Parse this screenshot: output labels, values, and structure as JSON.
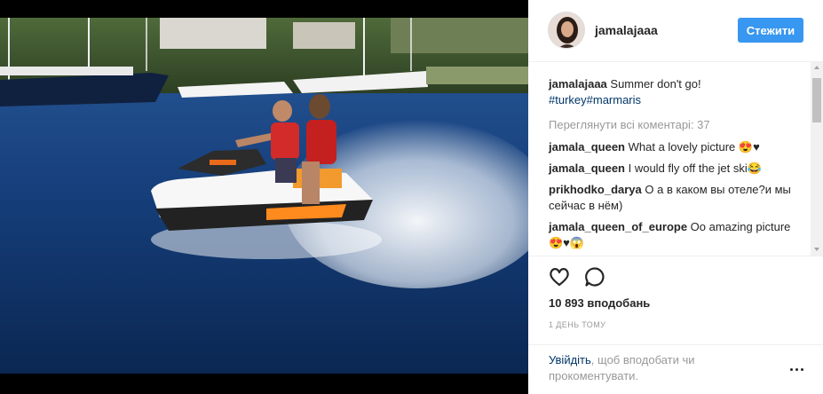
{
  "post": {
    "username": "jamalajaaa",
    "follow_label": "Стежити"
  },
  "caption": {
    "username": "jamalajaaa",
    "text": " Summer don't go!",
    "tags": "#turkey#marmaris"
  },
  "view_all_comments": "Переглянути всі коментарі: 37",
  "comments": [
    {
      "user": "jamala_queen",
      "text": " What a lovely picture 😍♥"
    },
    {
      "user": "jamala_queen",
      "text": " I would fly off the jet ski😂"
    },
    {
      "user": "prikhodko_darya",
      "text": " О а в каком вы отеле?и мы сейчас в нём)"
    },
    {
      "user": "jamala_queen_of_europe",
      "text": " Oo amazing picture 😍♥😱"
    }
  ],
  "actions": {
    "like_icon": "heart-outline-icon",
    "comment_icon": "speech-bubble-icon"
  },
  "likes": "10 893 вподобань",
  "timestamp": "1 день тому",
  "login_prompt": {
    "link": "Увійдіть",
    "text": ", щоб вподобати чи прокоментувати."
  },
  "more_icon": "ellipsis-icon",
  "colors": {
    "follow_button": "#3897f0",
    "link": "#003569",
    "muted": "#999999"
  }
}
